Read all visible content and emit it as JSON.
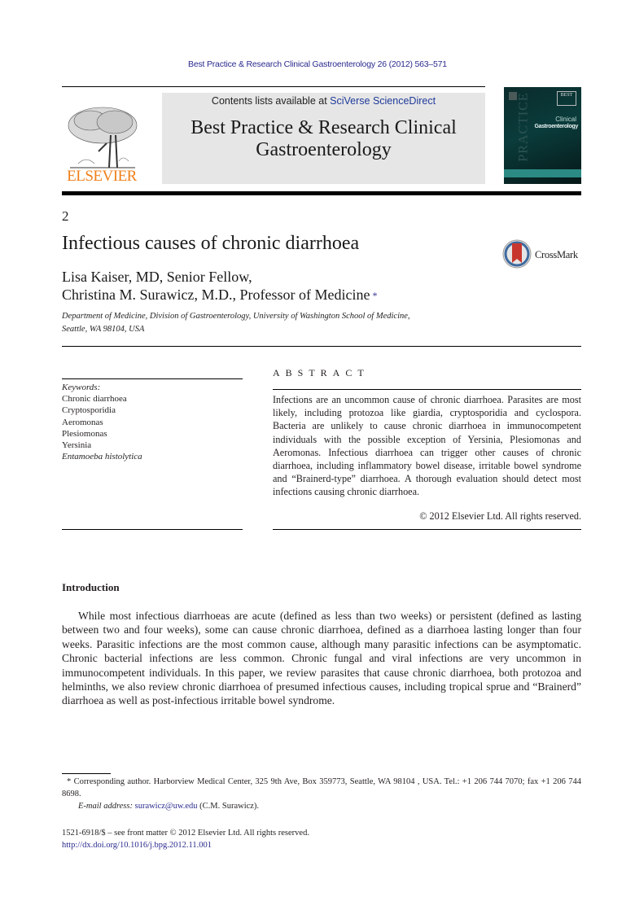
{
  "header": {
    "journal_ref": "Best Practice & Research Clinical Gastroenterology 26 (2012) 563–571",
    "contents_prefix": "Contents lists available at ",
    "contents_link": "SciVerse ScienceDirect",
    "journal_title_line1": "Best Practice & Research Clinical",
    "journal_title_line2": "Gastroenterology",
    "publisher_logo_text": "ELSEVIER",
    "cover": {
      "series_badge": "BEST",
      "side_text": "PRACTICE",
      "line1": "Clinical",
      "line2": "Gastroenterology"
    },
    "colors": {
      "publisher_orange": "#f07f1a",
      "link_blue": "#2b2b8f",
      "cover_teal": "#0a3c3b"
    }
  },
  "article": {
    "number": "2",
    "title": "Infectious causes of chronic diarrhoea",
    "crossmark_label": "CrossMark",
    "authors_line1": "Lisa Kaiser, MD, Senior Fellow,",
    "authors_line2": "Christina M. Surawicz, M.D., Professor of Medicine",
    "corresponding_marker": "*",
    "affiliation_line1": "Department of Medicine, Division of Gastroenterology, University of Washington School of Medicine,",
    "affiliation_line2": "Seattle, WA 98104, USA"
  },
  "keywords": {
    "label": "Keywords:",
    "items": [
      "Chronic diarrhoea",
      "Cryptosporidia",
      "Aeromonas",
      "Plesiomonas",
      "Yersinia",
      "Entamoeba histolytica"
    ]
  },
  "abstract": {
    "heading": "ABSTRACT",
    "text": "Infections are an uncommon cause of chronic diarrhoea. Parasites are most likely, including protozoa like giardia, cryptosporidia and cyclospora. Bacteria are unlikely to cause chronic diarrhoea in immunocompetent individuals with the possible exception of Yersinia, Plesiomonas and Aeromonas. Infectious diarrhoea can trigger other causes of chronic diarrhoea, including inflammatory bowel disease, irritable bowel syndrome and “Brainerd-type” diarrhoea. A thorough evaluation should detect most infections causing chronic diarrhoea.",
    "copyright": "© 2012 Elsevier Ltd. All rights reserved."
  },
  "introduction": {
    "heading": "Introduction",
    "paragraph": "While most infectious diarrhoeas are acute (defined as less than two weeks) or persistent (defined as lasting between two and four weeks), some can cause chronic diarrhoea, defined as a diarrhoea lasting longer than four weeks. Parasitic infections are the most common cause, although many parasitic infections can be asymptomatic. Chronic bacterial infections are less common. Chronic fungal and viral infections are very uncommon in immunocompetent individuals. In this paper, we review parasites that cause chronic diarrhoea, both protozoa and helminths, we also review chronic diarrhoea of presumed infectious causes, including tropical sprue and “Brainerd” diarrhoea as well as post-infectious irritable bowel syndrome."
  },
  "footnote": {
    "corresponding": "* Corresponding author. Harborview Medical Center, 325 9th Ave, Box 359773, Seattle, WA 98104 , USA. Tel.: +1 206 744 7070; fax +1 206 744 8698.",
    "email_label": "E-mail address:",
    "email": "surawicz@uw.edu",
    "email_suffix": " (C.M. Surawicz).",
    "issn": "1521-6918/$ – see front matter © 2012 Elsevier Ltd. All rights reserved.",
    "doi": "http://dx.doi.org/10.1016/j.bpg.2012.11.001"
  }
}
